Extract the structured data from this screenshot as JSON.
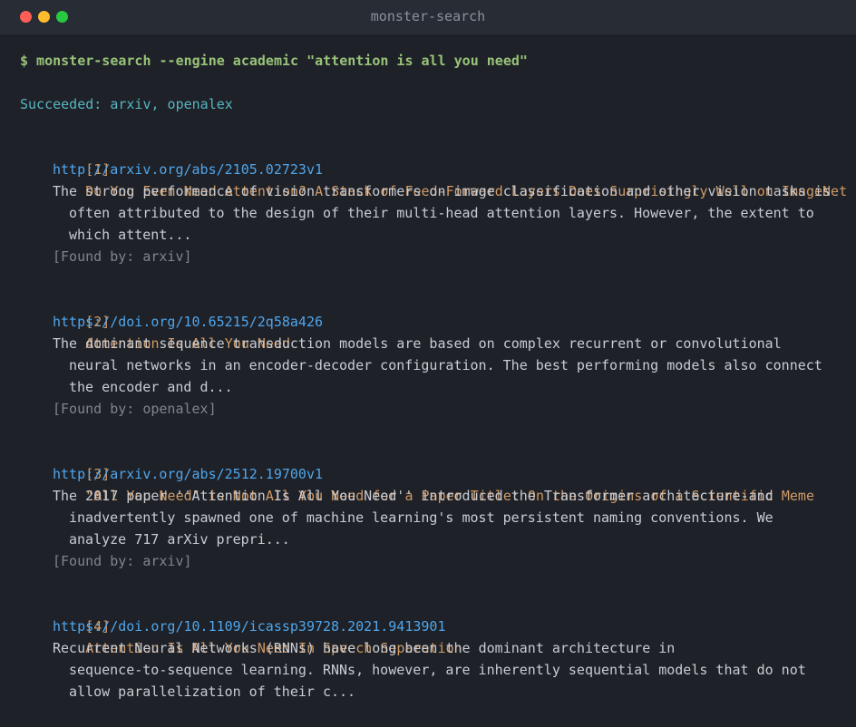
{
  "window": {
    "title": "monster-search"
  },
  "terminal": {
    "command": "$ monster-search --engine academic \"attention is all you need\"",
    "status": "Succeeded: arxiv, openalex",
    "results": [
      {
        "index": "[1]",
        "title": "Do You Even Need Attention? A Stack of Feed-Forward Layers Does Surprisingly Well on ImageNet",
        "url": "http://arxiv.org/abs/2105.02723v1",
        "snippet_lines": [
          "The strong performance of vision transformers on image classification and other vision tasks is",
          "often attributed to the design of their multi-head attention layers. However, the extent to",
          "which attent..."
        ],
        "found_by": "[Found by: arxiv]"
      },
      {
        "index": "[2]",
        "title": "Attention Is All You Need",
        "url": "https://doi.org/10.65215/2q58a426",
        "snippet_lines": [
          "The dominant sequence transduction models are based on complex recurrent or convolutional",
          "neural networks in an encoder-decoder configuration. The best performing models also connect",
          "the encoder and d..."
        ],
        "found_by": "[Found by: openalex]"
      },
      {
        "index": "[3]",
        "title": "\"All You Need\" is Not All You Need for a Paper Title: On the Origins of a Scientific Meme",
        "url": "http://arxiv.org/abs/2512.19700v1",
        "snippet_lines": [
          "The 2017 paper ''Attention Is All You Need'' introduced the Transformer architecture-and",
          "inadvertently spawned one of machine learning's most persistent naming conventions. We",
          "analyze 717 arXiv prepri..."
        ],
        "found_by": "[Found by: arxiv]"
      },
      {
        "index": "[4]",
        "title": "Attention Is All You Need In Speech Separation",
        "url": "https://doi.org/10.1109/icassp39728.2021.9413901",
        "snippet_lines": [
          "Recurrent Neural Networks (RNNs) have long been the dominant architecture in",
          "sequence-to-sequence learning. RNNs, however, are inherently sequential models that do not",
          "allow parallelization of their c..."
        ]
      }
    ]
  },
  "colors": {
    "background": "#1e2127",
    "titlebar": "#282c34",
    "command": "#98c379",
    "status": "#56b6c2",
    "result_title": "#d19a66",
    "url": "#4fa6ed",
    "snippet": "#c9ccd3",
    "found_by": "#7f848e"
  }
}
